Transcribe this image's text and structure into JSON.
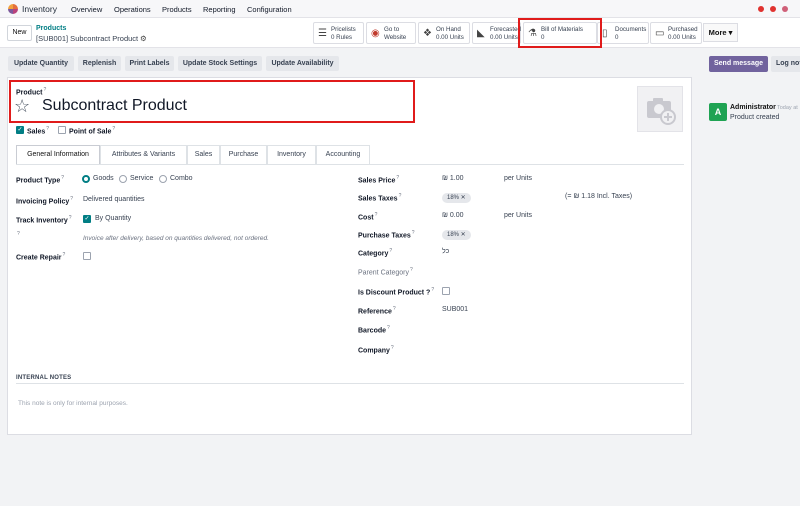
{
  "navbar": {
    "app_name": "Inventory",
    "menu": [
      "Overview",
      "Operations",
      "Products",
      "Reporting",
      "Configuration"
    ]
  },
  "breadcrumb": {
    "new_label": "New",
    "parent": "Products",
    "current": "[SUB001] Subcontract Product"
  },
  "smart_buttons": [
    {
      "icon": "list-icon",
      "line1": "Pricelists",
      "line2": "0 Rules"
    },
    {
      "icon": "globe-icon",
      "line1": "Go to",
      "line2": "Website"
    },
    {
      "icon": "cubes-icon",
      "line1": "On Hand",
      "line2": "0.00 Units"
    },
    {
      "icon": "area-chart-icon",
      "line1": "Forecasted",
      "line2": "0.00 Units"
    },
    {
      "icon": "flask-icon",
      "line1": "Bill of Materials",
      "line2": "0"
    },
    {
      "icon": "document-icon",
      "line1": "Documents",
      "line2": "0"
    },
    {
      "icon": "credit-card-icon",
      "line1": "Purchased",
      "line2": "0.00 Units"
    }
  ],
  "more_label": "More",
  "actions": [
    "Update Quantity",
    "Replenish",
    "Print Labels",
    "Update Stock Settings",
    "Update Availability"
  ],
  "chatter": {
    "send_message": "Send message",
    "log_note": "Log not",
    "avatar_letter": "A",
    "author": "Administrator",
    "time": "Today at",
    "message": "Product created"
  },
  "product": {
    "label": "Product",
    "name": "Subcontract Product",
    "sales_label": "Sales",
    "sales_checked": true,
    "pos_label": "Point of Sale",
    "pos_checked": false
  },
  "tabs": [
    "General Information",
    "Attributes & Variants",
    "Sales",
    "Purchase",
    "Inventory",
    "Accounting"
  ],
  "left_fields": {
    "product_type_label": "Product Type",
    "type_options": [
      "Goods",
      "Service",
      "Combo"
    ],
    "type_selected": "Goods",
    "invoicing_label": "Invoicing Policy",
    "invoicing_value": "Delivered quantities",
    "track_label": "Track Inventory",
    "track_value": "By Quantity",
    "invoice_help": "Invoice after delivery, based on quantities delivered, not ordered.",
    "repair_label": "Create Repair"
  },
  "right_fields": {
    "sales_price_label": "Sales Price",
    "sales_price": "₪ 1.00",
    "sales_price_unit": "per Units",
    "sales_taxes_label": "Sales Taxes",
    "sales_tax_tag": "18%",
    "sales_tax_incl": "(= ₪ 1.18 Incl. Taxes)",
    "cost_label": "Cost",
    "cost": "₪ 0.00",
    "cost_unit": "per Units",
    "purchase_taxes_label": "Purchase Taxes",
    "purchase_tax_tag": "18%",
    "category_label": "Category",
    "category": "כל",
    "parent_category_label": "Parent Category",
    "discount_label": "Is Discount Product ?",
    "reference_label": "Reference",
    "reference": "SUB001",
    "barcode_label": "Barcode",
    "company_label": "Company"
  },
  "notes": {
    "header": "INTERNAL NOTES",
    "placeholder": "This note is only for internal purposes."
  },
  "colors": {
    "accent": "#017e84",
    "primary_button": "#71639e",
    "highlight": "#e01b1b"
  }
}
